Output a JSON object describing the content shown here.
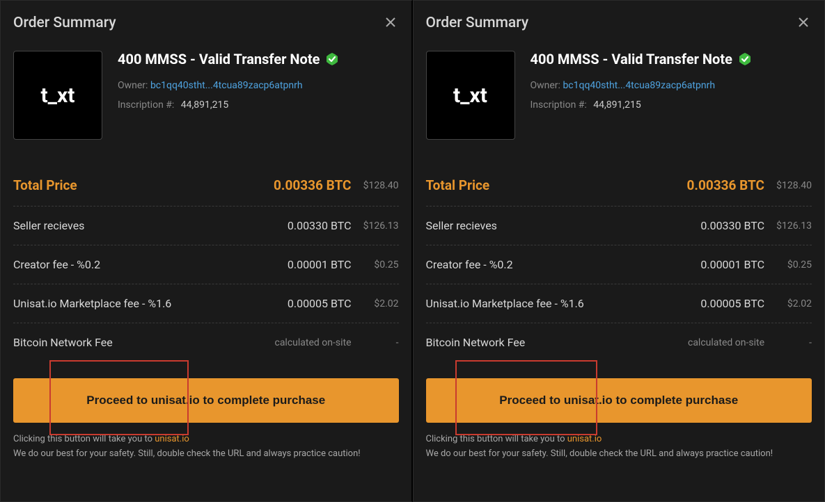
{
  "modal_title": "Order Summary",
  "thumb_text": "t_xt",
  "item": {
    "title": "400 MMSS - Valid Transfer Note",
    "owner_label": "Owner:",
    "owner_addr": "bc1qq40stht...4tcua89zacp6atpnrh",
    "inscription_label": "Inscription #:",
    "inscription_num": "44,891,215"
  },
  "rows": {
    "total": {
      "label": "Total Price",
      "btc": "0.00336 BTC",
      "usd": "$128.40"
    },
    "seller": {
      "label": "Seller recieves",
      "btc": "0.00330 BTC",
      "usd": "$126.13"
    },
    "creator": {
      "label": "Creator fee - %0.2",
      "btc": "0.00001 BTC",
      "usd": "$0.25"
    },
    "market": {
      "label": "Unisat.io Marketplace fee - %1.6",
      "btc": "0.00005 BTC",
      "usd": "$2.02"
    },
    "network": {
      "label": "Bitcoin Network Fee",
      "btc": "calculated on-site",
      "usd": "-"
    }
  },
  "button_label": "Proceed to unisat.io to complete purchase",
  "footnote": {
    "line1_prefix": "Clicking this button will take you to ",
    "line1_link": "unisat.io",
    "line2": "We do our best for your safety. Still, double check the URL and always practice caution!"
  }
}
